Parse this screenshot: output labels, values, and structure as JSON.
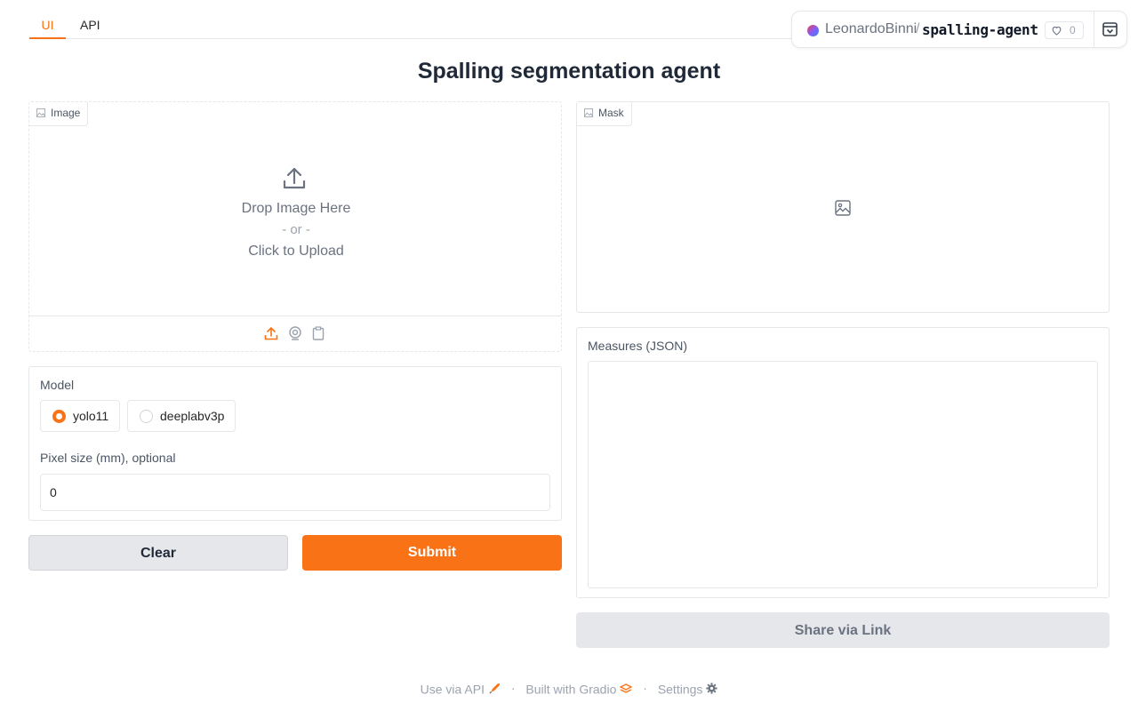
{
  "tabs": [
    {
      "label": "UI",
      "active": true
    },
    {
      "label": "API",
      "active": false
    }
  ],
  "space": {
    "owner": "LeonardoBinni",
    "separator": "/",
    "name": "spalling-agent",
    "likes": "0",
    "icons": {
      "like": "heart-icon",
      "collapse": "collapse-icon"
    }
  },
  "title": "Spalling segmentation agent",
  "image_input": {
    "label": "Image",
    "drop_text": "Drop Image Here",
    "or_text": "- or -",
    "click_text": "Click to Upload",
    "sources": [
      "upload-icon",
      "webcam-icon",
      "clipboard-icon"
    ]
  },
  "mask_output": {
    "label": "Mask"
  },
  "model": {
    "label": "Model",
    "options": [
      "yolo11",
      "deeplabv3p"
    ],
    "selected": "yolo11"
  },
  "pixel_size": {
    "label": "Pixel size (mm), optional",
    "value": "0"
  },
  "buttons": {
    "clear": "Clear",
    "submit": "Submit",
    "share": "Share via Link"
  },
  "measures": {
    "label": "Measures (JSON)"
  },
  "footer": {
    "api": "Use via API",
    "built": "Built with Gradio",
    "settings": "Settings",
    "separator": "·"
  },
  "colors": {
    "accent": "#f97316",
    "border": "#e5e7eb",
    "muted_text": "#9ca3af"
  }
}
